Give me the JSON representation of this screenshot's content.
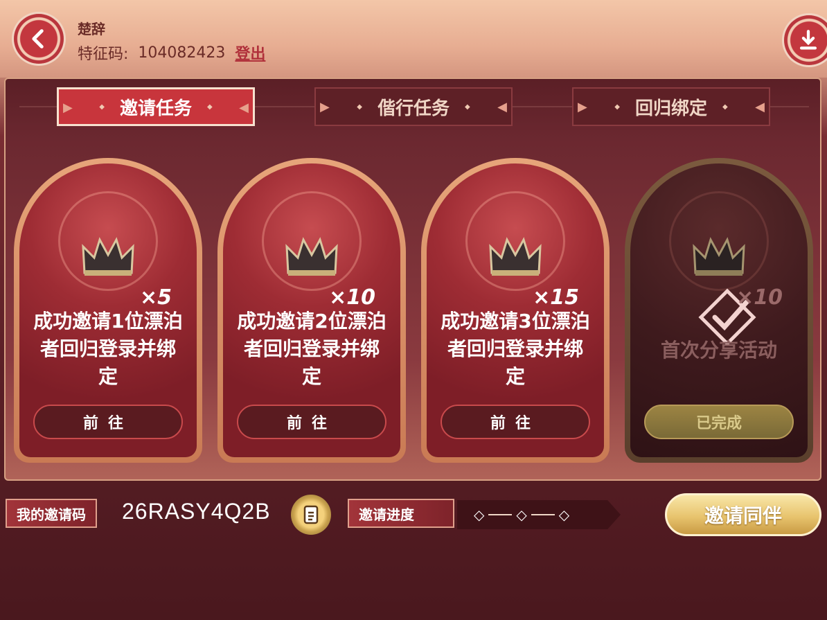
{
  "header": {
    "username": "楚辞",
    "code_label": "特征码:",
    "code_value": "104082423",
    "logout_label": "登出"
  },
  "tabs": [
    {
      "label": "邀请任务",
      "active": true
    },
    {
      "label": "偕行任务",
      "active": false
    },
    {
      "label": "回归绑定",
      "active": false
    }
  ],
  "cards": [
    {
      "qty": "×5",
      "desc": "成功邀请1位漂泊者回归登录并绑定",
      "button": "前往",
      "done": false
    },
    {
      "qty": "×10",
      "desc": "成功邀请2位漂泊者回归登录并绑定",
      "button": "前往",
      "done": false
    },
    {
      "qty": "×15",
      "desc": "成功邀请3位漂泊者回归登录并绑定",
      "button": "前往",
      "done": false
    },
    {
      "qty": "×10",
      "desc": "首次分享活动",
      "button": "已完成",
      "done": true
    }
  ],
  "footer": {
    "invite_code_label": "我的邀请码",
    "invite_code": "26RASY4Q2B",
    "progress_label": "邀请进度",
    "progress_completed": 0,
    "progress_total": 3,
    "invite_button": "邀请同伴"
  },
  "colors": {
    "accent_red": "#c8353c",
    "gold": "#e8c46e"
  },
  "icons": [
    "back-arrow-icon",
    "download-icon",
    "crown-icon",
    "check-icon",
    "copy-icon"
  ]
}
